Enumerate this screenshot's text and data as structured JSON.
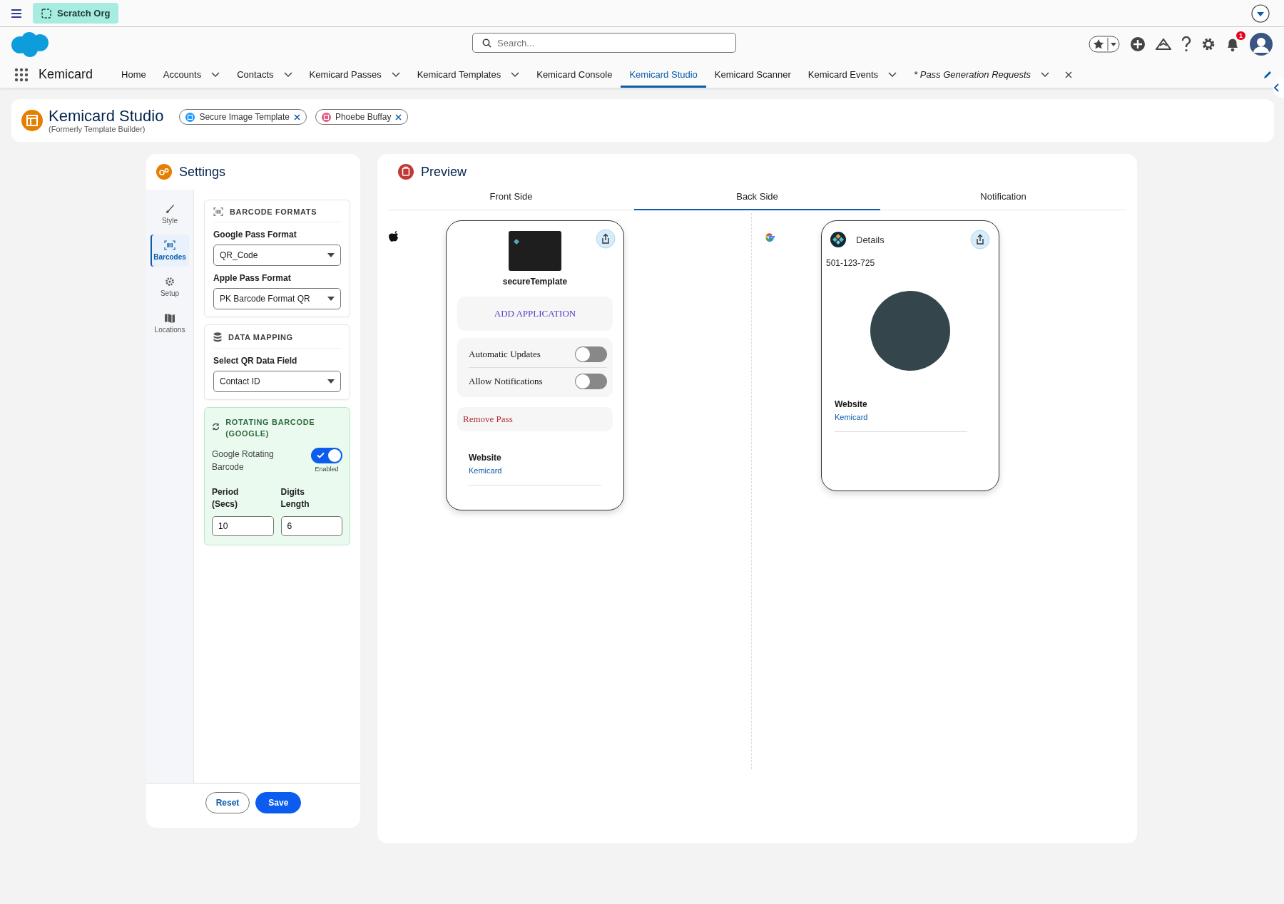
{
  "top_bar": {
    "org_label": "Scratch Org"
  },
  "header": {
    "search": {
      "placeholder": "Search..."
    },
    "notification_count": "1"
  },
  "nav": {
    "app_name": "Kemicard",
    "items": [
      {
        "label": "Home",
        "has_menu": false,
        "selected": false,
        "kind": "app"
      },
      {
        "label": "Accounts",
        "has_menu": true,
        "selected": false,
        "kind": "app"
      },
      {
        "label": "Contacts",
        "has_menu": true,
        "selected": false,
        "kind": "app"
      },
      {
        "label": "Kemicard Passes",
        "has_menu": true,
        "selected": false,
        "kind": "app"
      },
      {
        "label": "Kemicard Templates",
        "has_menu": true,
        "selected": false,
        "kind": "app"
      },
      {
        "label": "Kemicard Console",
        "has_menu": false,
        "selected": false,
        "kind": "app"
      },
      {
        "label": "Kemicard Studio",
        "has_menu": false,
        "selected": true,
        "kind": "app"
      },
      {
        "label": "Kemicard Scanner",
        "has_menu": false,
        "selected": false,
        "kind": "app"
      },
      {
        "label": "Kemicard Events",
        "has_menu": true,
        "selected": false,
        "kind": "app"
      },
      {
        "label": "* Pass Generation Requests",
        "has_menu": true,
        "selected": false,
        "kind": "workspace"
      }
    ]
  },
  "page_header": {
    "title": "Kemicard Studio",
    "subtitle": "(Formerly Template Builder)",
    "pills": [
      {
        "label": "Secure Image Template",
        "color": "#1b96ff"
      },
      {
        "label": "Phoebe Buffay",
        "color": "#e3577f"
      }
    ]
  },
  "settings": {
    "title": "Settings",
    "side_tabs": [
      {
        "label": "Style",
        "kind": "style",
        "selected": false
      },
      {
        "label": "Barcodes",
        "kind": "barcode",
        "selected": true
      },
      {
        "label": "Setup",
        "kind": "setup",
        "selected": false
      },
      {
        "label": "Locations",
        "kind": "locations",
        "selected": false
      }
    ],
    "sections": [
      {
        "title": "BARCODE FORMATS",
        "kind": "barcode",
        "fields": [
          {
            "label": "Google Pass Format",
            "value": "QR_Code"
          },
          {
            "label": "Apple Pass Format",
            "value": "PK Barcode Format QR"
          }
        ]
      },
      {
        "title": "DATA MAPPING",
        "kind": "database",
        "fields": [
          {
            "label": "Select QR Data Field",
            "value": "Contact ID"
          }
        ]
      }
    ],
    "rotating": {
      "title": "ROTATING BARCODE (GOOGLE)",
      "toggle": {
        "label": "Google Rotating Barcode",
        "on": true,
        "status": "Enabled"
      },
      "inputs": [
        {
          "label": "Period (Secs)",
          "value": "10"
        },
        {
          "label": "Digits Length",
          "value": "6"
        }
      ]
    },
    "buttons": [
      {
        "label": "Reset",
        "kind": "neutral"
      },
      {
        "label": "Save",
        "kind": "brand"
      }
    ]
  },
  "preview": {
    "title": "Preview",
    "tabs": [
      {
        "label": "Front Side",
        "selected": false
      },
      {
        "label": "Back Side",
        "selected": true
      },
      {
        "label": "Notification",
        "selected": false
      }
    ],
    "apple_pass": {
      "template_name": "secureTemplate",
      "action": "ADD APPLICATION",
      "toggles": [
        {
          "label": "Automatic Updates",
          "on": false
        },
        {
          "label": "Allow Notifications",
          "on": false
        }
      ],
      "remove": "Remove Pass",
      "field": {
        "label": "Website",
        "value": "Kemicard"
      }
    },
    "google_pass": {
      "title": "Details",
      "number": "501-123-725",
      "field": {
        "label": "Website",
        "value": "Kemicard"
      }
    }
  }
}
